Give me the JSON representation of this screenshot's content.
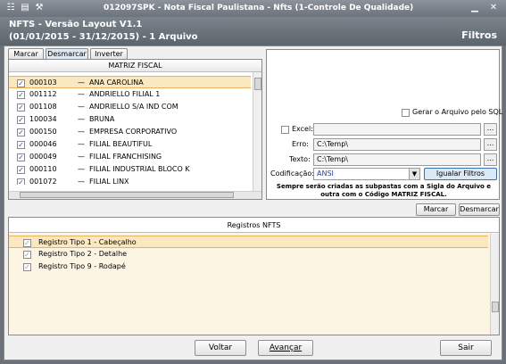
{
  "window": {
    "title": "012097SPK - Nota Fiscal Paulistana - Nfts (1-Controle De Qualidade)",
    "icons": [
      "app-icon",
      "form-icon",
      "wrench-icon"
    ]
  },
  "header": {
    "line1": "NFTS - Versão Layout V1.1",
    "line2": "(01/01/2015 - 31/12/2015) - 1 Arquivo",
    "section": "Filtros"
  },
  "toolbar": {
    "marcar": "Marcar",
    "desmarcar": "Desmarcar",
    "inverter": "Inverter"
  },
  "matriz": {
    "header": "MATRIZ FISCAL",
    "dash": "—",
    "rows": [
      {
        "code": "000103",
        "name": "ANA CAROLINA"
      },
      {
        "code": "001112",
        "name": "ANDRIELLO FILIAL 1"
      },
      {
        "code": "001108",
        "name": "ANDRIELLO S/A IND COM"
      },
      {
        "code": "100034",
        "name": "BRUNA"
      },
      {
        "code": "000150",
        "name": "EMPRESA CORPORATIVO"
      },
      {
        "code": "000046",
        "name": "FILIAL BEAUTIFUL"
      },
      {
        "code": "000049",
        "name": "FILIAL FRANCHISING"
      },
      {
        "code": "000110",
        "name": "FILIAL INDUSTRIAL BLOCO K"
      },
      {
        "code": "001072",
        "name": "FILIAL LINX"
      }
    ]
  },
  "options": {
    "gerar_sql": "Gerar o Arquivo pelo SQL",
    "excel_label": "Excel:",
    "excel_value": "",
    "erro_label": "Erro:",
    "erro_value": "C:\\Temp\\",
    "texto_label": "Texto:",
    "texto_value": "C:\\Temp\\",
    "codificacao_label": "Codificação:",
    "codificacao_value": "ANSI",
    "igualar": "Igualar Filtros",
    "dots": "...",
    "note": "Sempre serão criadas as subpastas com a Sigla do Arquivo e outra com o Código MATRIZ FISCAL."
  },
  "registros": {
    "marcar": "Marcar",
    "desmarcar": "Desmarcar",
    "header": "Registros NFTS",
    "rows": [
      "Registro Tipo 1 - Cabeçalho",
      "Registro Tipo 2 - Detalhe",
      "Registro Tipo 9 - Rodapé"
    ]
  },
  "footer": {
    "voltar": "Voltar",
    "avancar": "Avançar",
    "sair": "Sair"
  },
  "colors": {
    "selection": "#fbe8c0",
    "selection_border": "#e6b25f",
    "titlebar": "#767e86",
    "highlight_text": "#1f3fa8"
  }
}
